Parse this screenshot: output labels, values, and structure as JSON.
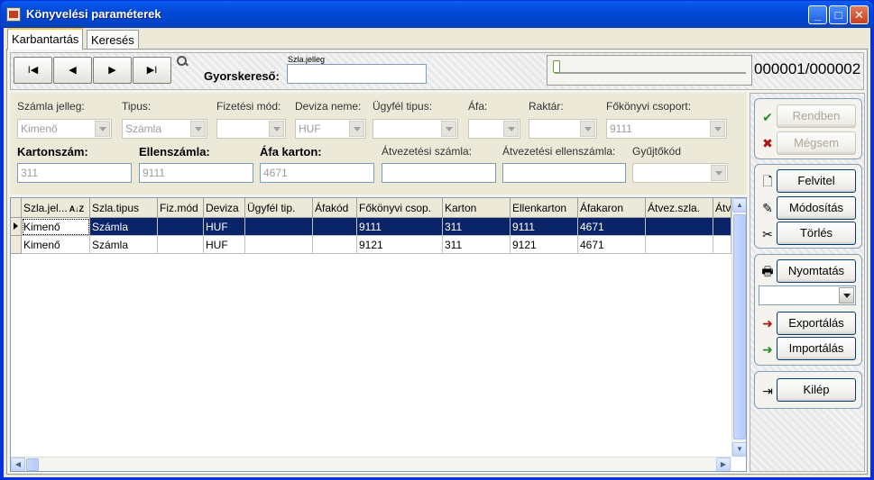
{
  "window": {
    "title": "Könyvelési paraméterek"
  },
  "tabs": [
    {
      "label": "Karbantartás"
    },
    {
      "label": "Keresés"
    }
  ],
  "nav": {
    "first": "I◀",
    "prev": "◀",
    "next": "▶",
    "last": "▶I"
  },
  "search": {
    "field_caption": "Szla.jelleg",
    "label": "Gyorskereső:",
    "value": ""
  },
  "record_counter": "000001/000002",
  "record_progress": 0.0,
  "filters": {
    "szamla_jelleg": {
      "label": "Számla jelleg:",
      "value": "Kimenő"
    },
    "tipus": {
      "label": "Tipus:",
      "value": "Számla"
    },
    "fizetesi_mod": {
      "label": "Fizetési mód:",
      "value": ""
    },
    "deviza_neme": {
      "label": "Deviza neme:",
      "value": "HUF"
    },
    "ugyfel_tipus": {
      "label": "Ügyfél tipus:",
      "value": ""
    },
    "afa": {
      "label": "Áfa:",
      "value": ""
    },
    "raktar": {
      "label": "Raktár:",
      "value": ""
    },
    "fokonyvi_csoport": {
      "label": "Főkönyvi csoport:",
      "value": "9111"
    },
    "kartonszam": {
      "label": "Kartonszám:",
      "value": "311"
    },
    "ellenszamla": {
      "label": "Ellenszámla:",
      "value": "9111"
    },
    "afa_karton": {
      "label": "Áfa karton:",
      "value": "4671"
    },
    "atvezetesi_szamla": {
      "label": "Átvezetési számla:",
      "value": ""
    },
    "atvezetesi_ellenszamla": {
      "label": "Átvezetési ellenszámla:",
      "value": ""
    },
    "gyujtokod": {
      "label": "Gyűjtőkód",
      "value": ""
    }
  },
  "grid": {
    "columns": [
      "Szla.jel...",
      "Szla.tipus",
      "Fiz.mód",
      "Deviza",
      "Ügyfél tip.",
      "Áfakód",
      "Főkönyvi csop.",
      "Karton",
      "Ellenkarton",
      "Áfakaron",
      "Átvez.szla.",
      "Átv"
    ],
    "sort_indicator": "A↓Z",
    "rows": [
      [
        "Kimenő",
        "Számla",
        "",
        "HUF",
        "",
        "",
        "9111",
        "311",
        "9111",
        "4671",
        "",
        ""
      ],
      [
        "Kimenő",
        "Számla",
        "",
        "HUF",
        "",
        "",
        "9121",
        "311",
        "9121",
        "4671",
        "",
        ""
      ]
    ]
  },
  "actions": {
    "ok": "Rendben",
    "cancel": "Mégsem",
    "new": "Felvitel",
    "modify": "Módosítás",
    "delete": "Törlés",
    "print": "Nyomtatás",
    "print_option": "",
    "export": "Exportálás",
    "import": "Importálás",
    "exit": "Kilép"
  }
}
